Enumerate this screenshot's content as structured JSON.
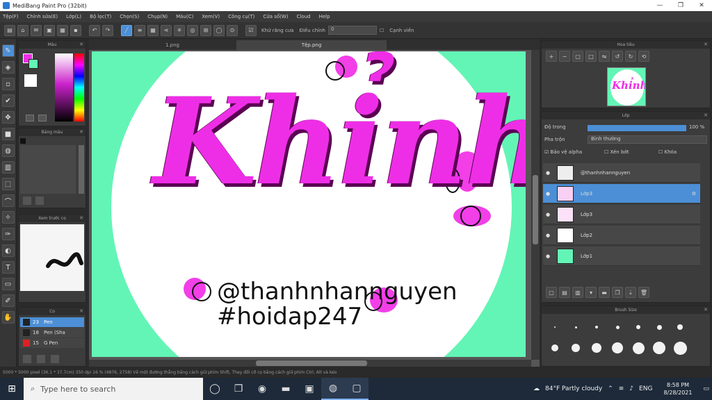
{
  "app": {
    "title": "MediBang Paint Pro (32bit)",
    "window_buttons": [
      "—",
      "❐",
      "✕"
    ]
  },
  "menu": [
    "Tệp(F)",
    "Chỉnh sửa(E)",
    "Lớp(L)",
    "Bộ lọc(T)",
    "Chọn(S)",
    "Chụp(N)",
    "Màu(C)",
    "Xem(V)",
    "Công cụ(T)",
    "Cửa sổ(W)",
    "Cloud",
    "Help"
  ],
  "toolbar": {
    "snap_label": "Khử răng cưa",
    "correction_label": "Điều chỉnh",
    "correction_value": "0",
    "edge_label": "Cạnh viền"
  },
  "panels": {
    "color_title": "Màu",
    "palette_title": "Bảng màu",
    "brush_preview_title": "Xem trước cọ",
    "brush_list_title": "Cọ",
    "navigator_title": "Hoa tiêu",
    "layer_title": "Lớp",
    "brush_size_title": "Brush Size"
  },
  "brushes": [
    {
      "size": "23",
      "name": "Pen"
    },
    {
      "size": "18",
      "name": "Pen (Sha"
    },
    {
      "size": "15",
      "name": "G Pen"
    }
  ],
  "canvas": {
    "tabs": [
      "1.png",
      "Tệp.png"
    ],
    "khinh_text": "Khỉnh",
    "handle_text": "@thanhnhannguyen",
    "hashtag_text": "#hoidap247",
    "colors": {
      "background": "#63f5b6",
      "circle": "#ffffff",
      "accent": "#ee2ee6",
      "shadow": "#5a0052"
    }
  },
  "layers": {
    "opacity_label": "Độ trong",
    "opacity_value": "100 %",
    "blend_label": "Pha trộn",
    "blend_value": "Bình thường",
    "protect_alpha": "Bảo vệ alpha",
    "clipping": "Xén bớt",
    "lock": "Khóa",
    "items": [
      {
        "name": "@thanhnhannguyen",
        "selected": false
      },
      {
        "name": "Lớp3",
        "selected": true
      },
      {
        "name": "Lớp3",
        "selected": false
      },
      {
        "name": "Lớp2",
        "selected": false
      },
      {
        "name": "Lớp1",
        "selected": false
      }
    ]
  },
  "brush_sizes": [
    "1",
    "1.5",
    "2",
    "3",
    "4",
    "5",
    "7",
    "10",
    "12",
    "15",
    "20",
    "25",
    "30",
    "40"
  ],
  "status": "5000 * 5000 pixel   (36.1 * 37.7cm)   350 dpi   16 %   (4876, 2758)   Vẽ một đường thẳng bằng cách giữ phím Shift, Thay đổi cỡ cọ bằng cách giữ phím Ctrl, Alt và kéo",
  "taskbar": {
    "search_placeholder": "Type here to search",
    "weather": "84°F  Partly cloudy",
    "lang": "ENG",
    "time": "8:58 PM",
    "date": "8/28/2021"
  }
}
